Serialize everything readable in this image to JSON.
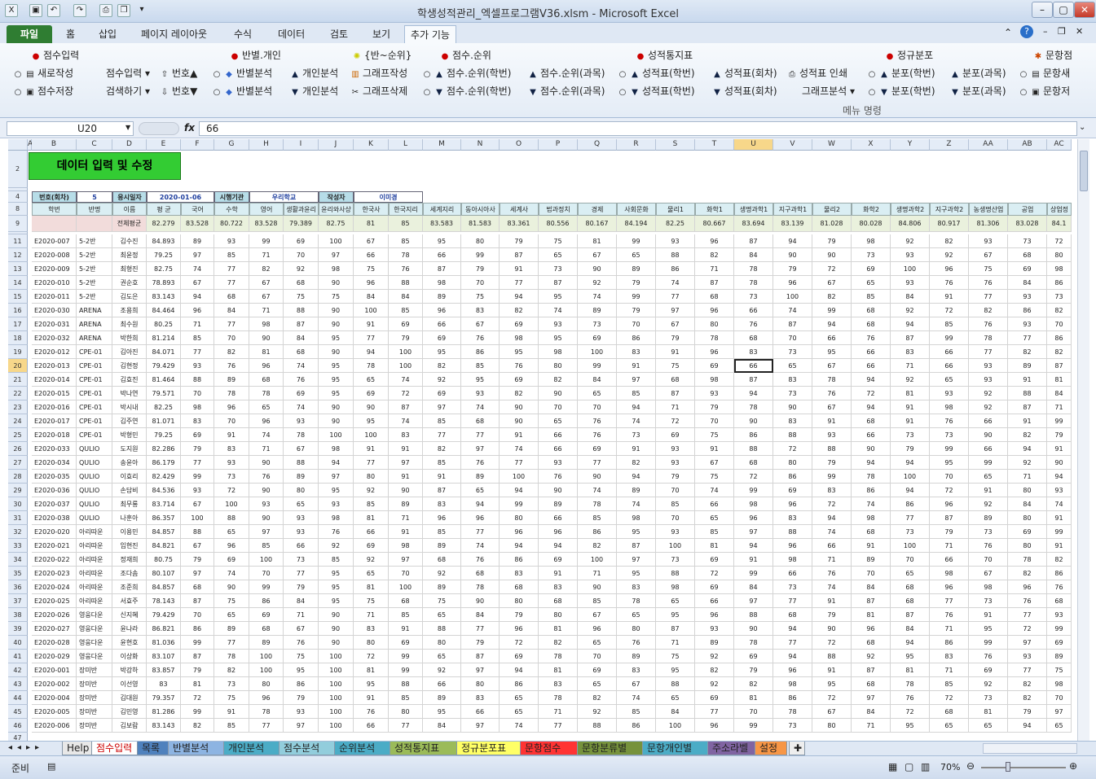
{
  "title": "학생성적관리_엑셀프로그램V36.xlsm  -  Microsoft Excel",
  "tabs": [
    "파일",
    "홈",
    "삽입",
    "페이지 레이아웃",
    "수식",
    "데이터",
    "검토",
    "보기",
    "추가 기능"
  ],
  "ribbon": {
    "groups": [
      {
        "header": "점수입력",
        "items": [
          "새로작성",
          "점수저장",
          "점수입력 ▾",
          "검색하기 ▾",
          "번호▲",
          "번호▼"
        ]
      },
      {
        "header": "반별.개인",
        "items": [
          "반별분석",
          "반별분석",
          "개인분석",
          "개인분석"
        ]
      },
      {
        "header": "{반~순위}",
        "items": [
          "그래프작성",
          "그래프삭제"
        ]
      },
      {
        "header": "점수.순위",
        "items": [
          "점수.순위(학번)",
          "점수.순위(학번)",
          "점수.순위(과목)",
          "점수.순위(과목)"
        ]
      },
      {
        "header": "성적통지표",
        "items": [
          "성적표(학번)",
          "성적표(학번)",
          "성적표(회차)",
          "성적표(회차)",
          "성적표 인쇄",
          "그래프분석 ▾"
        ]
      },
      {
        "header": "정규분포",
        "items": [
          "분포(학번)",
          "분포(학번)",
          "분포(과목)",
          "분포(과목)"
        ]
      },
      {
        "header": "문항점",
        "items": [
          "문항새",
          "문항저"
        ]
      }
    ],
    "group_label": "메뉴 명령"
  },
  "namebox": "U20",
  "formula": "66",
  "columns": [
    "A",
    "B",
    "C",
    "D",
    "E",
    "F",
    "G",
    "H",
    "I",
    "J",
    "K",
    "L",
    "M",
    "N",
    "O",
    "P",
    "Q",
    "R",
    "S",
    "T",
    "U",
    "V",
    "W",
    "X",
    "Y",
    "Z",
    "AA",
    "AB",
    "AC"
  ],
  "selected_col": "U",
  "selected_row": 20,
  "sheet_title": "데이터 입력 및 수정",
  "info": {
    "l1": "번호(회차)",
    "v1": "5",
    "l2": "응시일자",
    "v2": "2020-01-06",
    "l3": "시행기관",
    "v3": "우리학교",
    "l4": "작성자",
    "v4": "이미경"
  },
  "header8": [
    "학번",
    "반명",
    "이름",
    "평 균",
    "국어",
    "수학",
    "영어",
    "생활과윤리",
    "윤리와사상",
    "한국사",
    "한국지리",
    "세계지리",
    "동아시아사",
    "세계사",
    "법과정치",
    "경제",
    "사회문화",
    "물리1",
    "화학1",
    "생명과학1",
    "지구과학1",
    "물리2",
    "화학2",
    "생명과학2",
    "지구과학2",
    "농생명산업",
    "공업",
    "상업정"
  ],
  "avg_label": "전체평균",
  "avg": [
    "82.279",
    "83.528",
    "80.722",
    "83.528",
    "79.389",
    "82.75",
    "81",
    "85",
    "83.583",
    "81.583",
    "83.361",
    "80.556",
    "80.167",
    "84.194",
    "82.25",
    "80.667",
    "83.694",
    "83.139",
    "81.028",
    "80.028",
    "84.806",
    "80.917",
    "81.306",
    "83.028",
    "84.1"
  ],
  "rows": [
    [
      "E2020-007",
      "5-2반",
      "김수진",
      "84.893",
      "89",
      "93",
      "99",
      "69",
      "100",
      "67",
      "85",
      "95",
      "80",
      "79",
      "75",
      "81",
      "99",
      "93",
      "96",
      "87",
      "94",
      "79",
      "98",
      "92",
      "82",
      "93",
      "73",
      "72"
    ],
    [
      "E2020-008",
      "5-2반",
      "최윤정",
      "79.25",
      "97",
      "85",
      "71",
      "70",
      "97",
      "66",
      "78",
      "66",
      "99",
      "87",
      "65",
      "67",
      "65",
      "88",
      "82",
      "84",
      "90",
      "90",
      "73",
      "93",
      "92",
      "67",
      "68",
      "80"
    ],
    [
      "E2020-009",
      "5-2반",
      "최형진",
      "82.75",
      "74",
      "77",
      "82",
      "92",
      "98",
      "75",
      "76",
      "87",
      "79",
      "91",
      "73",
      "90",
      "89",
      "86",
      "71",
      "78",
      "79",
      "72",
      "69",
      "100",
      "96",
      "75",
      "69",
      "98"
    ],
    [
      "E2020-010",
      "5-2반",
      "권순호",
      "78.893",
      "67",
      "77",
      "67",
      "68",
      "90",
      "96",
      "88",
      "98",
      "70",
      "77",
      "87",
      "92",
      "79",
      "74",
      "87",
      "78",
      "96",
      "67",
      "65",
      "93",
      "76",
      "76",
      "84",
      "86"
    ],
    [
      "E2020-011",
      "5-2반",
      "김도은",
      "83.143",
      "94",
      "68",
      "67",
      "75",
      "75",
      "84",
      "84",
      "89",
      "75",
      "94",
      "95",
      "74",
      "99",
      "77",
      "68",
      "73",
      "100",
      "82",
      "85",
      "84",
      "91",
      "77",
      "93",
      "73"
    ],
    [
      "E2020-030",
      "ARENA",
      "조용희",
      "84.464",
      "96",
      "84",
      "71",
      "88",
      "90",
      "100",
      "85",
      "96",
      "83",
      "82",
      "74",
      "89",
      "79",
      "97",
      "96",
      "66",
      "74",
      "99",
      "68",
      "92",
      "72",
      "82",
      "86",
      "82"
    ],
    [
      "E2020-031",
      "ARENA",
      "최수원",
      "80.25",
      "71",
      "77",
      "98",
      "87",
      "90",
      "91",
      "69",
      "66",
      "67",
      "69",
      "93",
      "73",
      "70",
      "67",
      "80",
      "76",
      "87",
      "94",
      "68",
      "94",
      "85",
      "76",
      "93",
      "70"
    ],
    [
      "E2020-032",
      "ARENA",
      "박한희",
      "81.214",
      "85",
      "70",
      "90",
      "84",
      "95",
      "77",
      "79",
      "69",
      "76",
      "98",
      "95",
      "69",
      "86",
      "79",
      "78",
      "68",
      "70",
      "66",
      "76",
      "87",
      "99",
      "78",
      "77",
      "86"
    ],
    [
      "E2020-012",
      "CPE-01",
      "김아진",
      "84.071",
      "77",
      "82",
      "81",
      "68",
      "90",
      "94",
      "100",
      "95",
      "86",
      "95",
      "98",
      "100",
      "83",
      "91",
      "96",
      "83",
      "73",
      "95",
      "66",
      "83",
      "66",
      "77",
      "82",
      "82"
    ],
    [
      "E2020-013",
      "CPE-01",
      "김현정",
      "79.429",
      "93",
      "76",
      "96",
      "74",
      "95",
      "78",
      "100",
      "82",
      "85",
      "76",
      "80",
      "99",
      "91",
      "75",
      "69",
      "66",
      "65",
      "67",
      "66",
      "71",
      "66",
      "93",
      "89",
      "87"
    ],
    [
      "E2020-014",
      "CPE-01",
      "김효진",
      "81.464",
      "88",
      "89",
      "68",
      "76",
      "95",
      "65",
      "74",
      "92",
      "95",
      "69",
      "82",
      "84",
      "97",
      "68",
      "98",
      "87",
      "83",
      "78",
      "94",
      "92",
      "65",
      "93",
      "91",
      "81"
    ],
    [
      "E2020-015",
      "CPE-01",
      "박나연",
      "79.571",
      "70",
      "78",
      "78",
      "69",
      "95",
      "69",
      "72",
      "69",
      "93",
      "82",
      "90",
      "65",
      "85",
      "87",
      "93",
      "94",
      "73",
      "76",
      "72",
      "81",
      "93",
      "92",
      "88",
      "84"
    ],
    [
      "E2020-016",
      "CPE-01",
      "박시내",
      "82.25",
      "98",
      "96",
      "65",
      "74",
      "90",
      "90",
      "87",
      "97",
      "74",
      "90",
      "70",
      "70",
      "94",
      "71",
      "79",
      "78",
      "90",
      "67",
      "94",
      "91",
      "98",
      "92",
      "87",
      "71"
    ],
    [
      "E2020-017",
      "CPE-01",
      "김주연",
      "81.071",
      "83",
      "70",
      "96",
      "93",
      "90",
      "95",
      "74",
      "85",
      "68",
      "90",
      "65",
      "76",
      "74",
      "72",
      "70",
      "90",
      "83",
      "91",
      "68",
      "91",
      "76",
      "66",
      "91",
      "99"
    ],
    [
      "E2020-018",
      "CPE-01",
      "박형민",
      "79.25",
      "69",
      "91",
      "74",
      "78",
      "100",
      "100",
      "83",
      "77",
      "77",
      "91",
      "66",
      "76",
      "73",
      "69",
      "75",
      "86",
      "88",
      "93",
      "66",
      "73",
      "73",
      "90",
      "82",
      "79"
    ],
    [
      "E2020-033",
      "QULIO",
      "도지원",
      "82.286",
      "79",
      "83",
      "71",
      "67",
      "98",
      "91",
      "91",
      "82",
      "97",
      "74",
      "66",
      "69",
      "91",
      "93",
      "91",
      "88",
      "72",
      "88",
      "90",
      "79",
      "99",
      "66",
      "94",
      "91"
    ],
    [
      "E2020-034",
      "QULIO",
      "송윤아",
      "86.179",
      "77",
      "93",
      "90",
      "88",
      "94",
      "77",
      "97",
      "85",
      "76",
      "77",
      "93",
      "77",
      "82",
      "93",
      "67",
      "68",
      "80",
      "79",
      "94",
      "94",
      "95",
      "99",
      "92",
      "90"
    ],
    [
      "E2020-035",
      "QULIO",
      "이효리",
      "82.429",
      "99",
      "73",
      "76",
      "89",
      "97",
      "80",
      "91",
      "91",
      "89",
      "100",
      "76",
      "90",
      "94",
      "79",
      "75",
      "72",
      "86",
      "99",
      "78",
      "100",
      "70",
      "65",
      "71",
      "94"
    ],
    [
      "E2020-036",
      "QULIO",
      "손담비",
      "84.536",
      "93",
      "72",
      "90",
      "80",
      "95",
      "92",
      "90",
      "87",
      "65",
      "94",
      "90",
      "74",
      "89",
      "70",
      "74",
      "99",
      "69",
      "83",
      "86",
      "94",
      "72",
      "91",
      "80",
      "93"
    ],
    [
      "E2020-037",
      "QULIO",
      "최무룡",
      "83.714",
      "67",
      "100",
      "93",
      "65",
      "93",
      "85",
      "89",
      "83",
      "94",
      "99",
      "89",
      "78",
      "74",
      "85",
      "66",
      "98",
      "96",
      "72",
      "74",
      "86",
      "96",
      "92",
      "84",
      "74"
    ],
    [
      "E2020-038",
      "QULIO",
      "나훈아",
      "86.357",
      "100",
      "88",
      "90",
      "93",
      "98",
      "81",
      "71",
      "96",
      "96",
      "80",
      "66",
      "85",
      "98",
      "70",
      "65",
      "96",
      "83",
      "94",
      "98",
      "77",
      "87",
      "89",
      "80",
      "91"
    ],
    [
      "E2020-020",
      "아리따운",
      "이용민",
      "84.857",
      "88",
      "65",
      "97",
      "93",
      "76",
      "66",
      "91",
      "85",
      "77",
      "96",
      "96",
      "86",
      "95",
      "93",
      "85",
      "97",
      "88",
      "74",
      "68",
      "73",
      "79",
      "73",
      "69",
      "99"
    ],
    [
      "E2020-021",
      "아리따운",
      "임현진",
      "84.821",
      "67",
      "96",
      "85",
      "66",
      "92",
      "69",
      "98",
      "89",
      "74",
      "94",
      "94",
      "82",
      "87",
      "100",
      "81",
      "94",
      "96",
      "66",
      "91",
      "100",
      "71",
      "76",
      "80",
      "91"
    ],
    [
      "E2020-022",
      "아리따운",
      "정재희",
      "80.75",
      "79",
      "69",
      "100",
      "73",
      "85",
      "92",
      "97",
      "68",
      "76",
      "86",
      "69",
      "100",
      "97",
      "73",
      "69",
      "91",
      "98",
      "71",
      "89",
      "70",
      "66",
      "70",
      "78",
      "82"
    ],
    [
      "E2020-023",
      "아리따운",
      "조다솜",
      "80.107",
      "97",
      "74",
      "70",
      "77",
      "95",
      "65",
      "70",
      "92",
      "68",
      "83",
      "91",
      "71",
      "95",
      "88",
      "72",
      "99",
      "66",
      "76",
      "70",
      "65",
      "98",
      "67",
      "82",
      "86"
    ],
    [
      "E2020-024",
      "아리따운",
      "조준희",
      "84.857",
      "68",
      "90",
      "99",
      "79",
      "95",
      "81",
      "100",
      "89",
      "78",
      "68",
      "83",
      "90",
      "83",
      "98",
      "69",
      "84",
      "73",
      "74",
      "84",
      "68",
      "96",
      "98",
      "96",
      "76"
    ],
    [
      "E2020-025",
      "아리따운",
      "서효주",
      "78.143",
      "87",
      "75",
      "86",
      "84",
      "95",
      "75",
      "68",
      "75",
      "90",
      "80",
      "68",
      "85",
      "78",
      "65",
      "66",
      "97",
      "77",
      "91",
      "87",
      "68",
      "77",
      "73",
      "76",
      "68"
    ],
    [
      "E2020-026",
      "영웅다운",
      "신지혜",
      "79.429",
      "70",
      "65",
      "69",
      "71",
      "90",
      "71",
      "85",
      "65",
      "84",
      "79",
      "80",
      "67",
      "65",
      "95",
      "96",
      "88",
      "68",
      "79",
      "81",
      "87",
      "76",
      "91",
      "77",
      "93"
    ],
    [
      "E2020-027",
      "영웅다운",
      "윤나라",
      "86.821",
      "86",
      "89",
      "68",
      "67",
      "90",
      "83",
      "91",
      "88",
      "77",
      "96",
      "81",
      "96",
      "80",
      "87",
      "93",
      "90",
      "94",
      "90",
      "96",
      "84",
      "71",
      "95",
      "72",
      "99"
    ],
    [
      "E2020-028",
      "영웅다운",
      "윤현호",
      "81.036",
      "99",
      "77",
      "89",
      "76",
      "90",
      "80",
      "69",
      "80",
      "79",
      "72",
      "82",
      "65",
      "76",
      "71",
      "89",
      "78",
      "77",
      "72",
      "68",
      "94",
      "86",
      "99",
      "97",
      "69"
    ],
    [
      "E2020-029",
      "영웅다운",
      "이상화",
      "83.107",
      "87",
      "78",
      "100",
      "75",
      "100",
      "72",
      "99",
      "65",
      "87",
      "69",
      "78",
      "70",
      "89",
      "75",
      "92",
      "69",
      "94",
      "88",
      "92",
      "95",
      "83",
      "76",
      "93",
      "89"
    ],
    [
      "E2020-001",
      "장미반",
      "박강하",
      "83.857",
      "79",
      "82",
      "100",
      "95",
      "100",
      "81",
      "99",
      "92",
      "97",
      "94",
      "81",
      "69",
      "83",
      "95",
      "82",
      "79",
      "96",
      "91",
      "87",
      "81",
      "71",
      "69",
      "77",
      "75"
    ],
    [
      "E2020-002",
      "장미반",
      "이선영",
      "83",
      "81",
      "73",
      "80",
      "86",
      "100",
      "95",
      "88",
      "66",
      "80",
      "86",
      "83",
      "65",
      "67",
      "88",
      "92",
      "82",
      "98",
      "95",
      "68",
      "78",
      "85",
      "92",
      "82",
      "98"
    ],
    [
      "E2020-004",
      "장미반",
      "김대원",
      "79.357",
      "72",
      "75",
      "96",
      "79",
      "100",
      "91",
      "85",
      "89",
      "83",
      "65",
      "78",
      "82",
      "74",
      "65",
      "69",
      "81",
      "86",
      "72",
      "97",
      "76",
      "72",
      "73",
      "82",
      "70"
    ],
    [
      "E2020-005",
      "장미반",
      "김민영",
      "81.286",
      "99",
      "91",
      "78",
      "93",
      "100",
      "76",
      "80",
      "95",
      "66",
      "65",
      "71",
      "92",
      "85",
      "84",
      "77",
      "70",
      "78",
      "67",
      "84",
      "72",
      "68",
      "81",
      "79",
      "97"
    ],
    [
      "E2020-006",
      "장미반",
      "김보람",
      "83.143",
      "82",
      "85",
      "77",
      "97",
      "100",
      "66",
      "77",
      "84",
      "97",
      "74",
      "77",
      "88",
      "86",
      "100",
      "96",
      "99",
      "73",
      "80",
      "71",
      "95",
      "65",
      "65",
      "94",
      "65"
    ]
  ],
  "sheet_tabs": [
    "Help",
    "점수입력",
    "목록",
    "반별분석",
    "개인분석",
    "점수분석",
    "순위분석",
    "성적통지표",
    "정규분포표",
    "문항점수",
    "문항분류별",
    "문항개인별",
    "주소라벨",
    "설정"
  ],
  "status": {
    "ready": "준비",
    "zoom": "70%"
  }
}
